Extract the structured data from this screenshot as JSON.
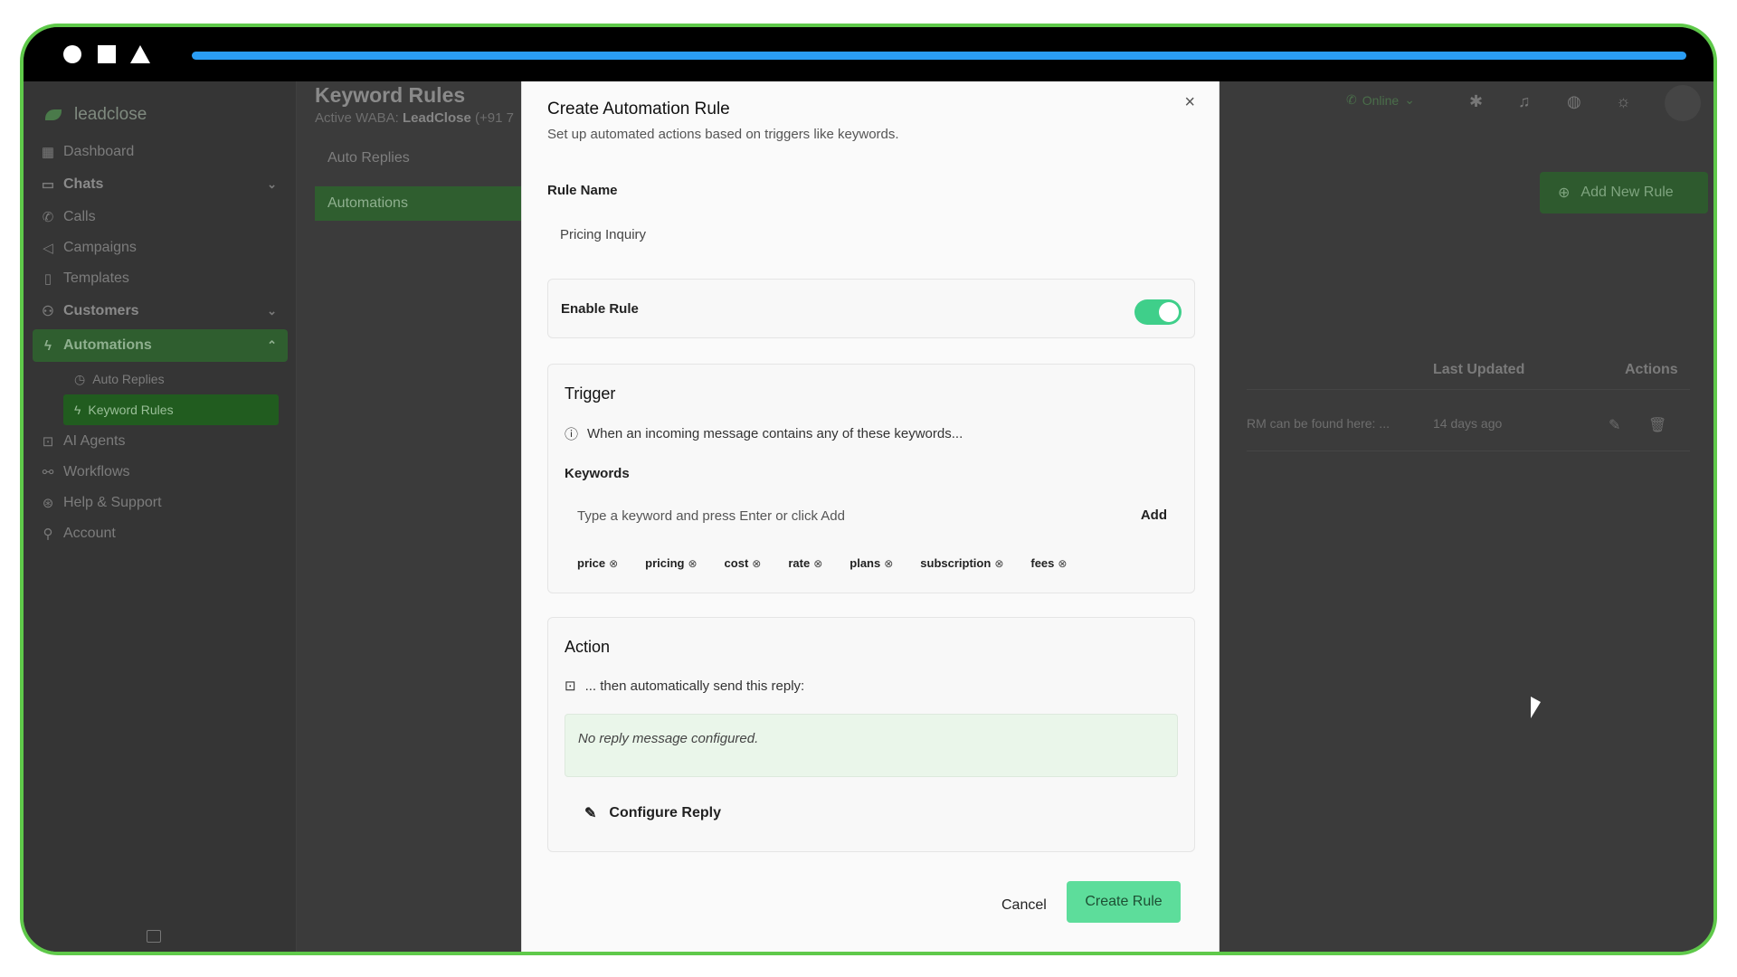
{
  "sidebar": {
    "brand": "leadclose",
    "items": [
      {
        "label": "Dashboard",
        "icon": "dashboard-icon"
      },
      {
        "label": "Chats",
        "icon": "chat-icon"
      },
      {
        "label": "Calls",
        "icon": "phone-icon"
      },
      {
        "label": "Campaigns",
        "icon": "megaphone-icon"
      },
      {
        "label": "Templates",
        "icon": "document-icon"
      },
      {
        "label": "Customers",
        "icon": "users-icon"
      },
      {
        "label": "Automations",
        "icon": "lightning-icon"
      },
      {
        "label": "AI Agents",
        "icon": "bot-icon"
      },
      {
        "label": "Workflows",
        "icon": "workflow-icon"
      },
      {
        "label": "Help & Support",
        "icon": "help-icon"
      },
      {
        "label": "Account",
        "icon": "account-icon"
      }
    ],
    "sub_items": [
      {
        "label": "Auto Replies",
        "icon": "clock-icon"
      },
      {
        "label": "Keyword Rules",
        "icon": "lightning-icon"
      }
    ]
  },
  "main": {
    "title": "Keyword Rules",
    "subtitle_prefix": "Active WABA: ",
    "subtitle_name": "LeadClose",
    "subtitle_suffix": " (+91 7",
    "tabs": [
      "Auto Replies",
      "Automations"
    ],
    "add_button": "Add New Rule",
    "status": "Online",
    "columns": {
      "last_updated": "Last Updated",
      "actions": "Actions"
    },
    "row": {
      "reply": "RM can be found here: ...",
      "updated": "14 days ago"
    }
  },
  "modal": {
    "title": "Create Automation Rule",
    "subtitle": "Set up automated actions based on triggers like keywords.",
    "rule_name_label": "Rule Name",
    "rule_name_value": "Pricing Inquiry",
    "enable_label": "Enable Rule",
    "enable_on": true,
    "trigger": {
      "title": "Trigger",
      "hint": "When an incoming message contains any of these keywords...",
      "keywords_label": "Keywords",
      "placeholder": "Type a keyword and press Enter or click Add",
      "add_label": "Add",
      "keywords": [
        "price",
        "pricing",
        "cost",
        "rate",
        "plans",
        "subscription",
        "fees"
      ]
    },
    "action": {
      "title": "Action",
      "hint": "... then automatically send this reply:",
      "reply_empty": "No reply message configured.",
      "configure_label": "Configure Reply"
    },
    "cancel_label": "Cancel",
    "create_label": "Create Rule"
  },
  "colors": {
    "accent": "#5ddd9b",
    "frame": "#5fc94a",
    "progress": "#2a9df4"
  }
}
